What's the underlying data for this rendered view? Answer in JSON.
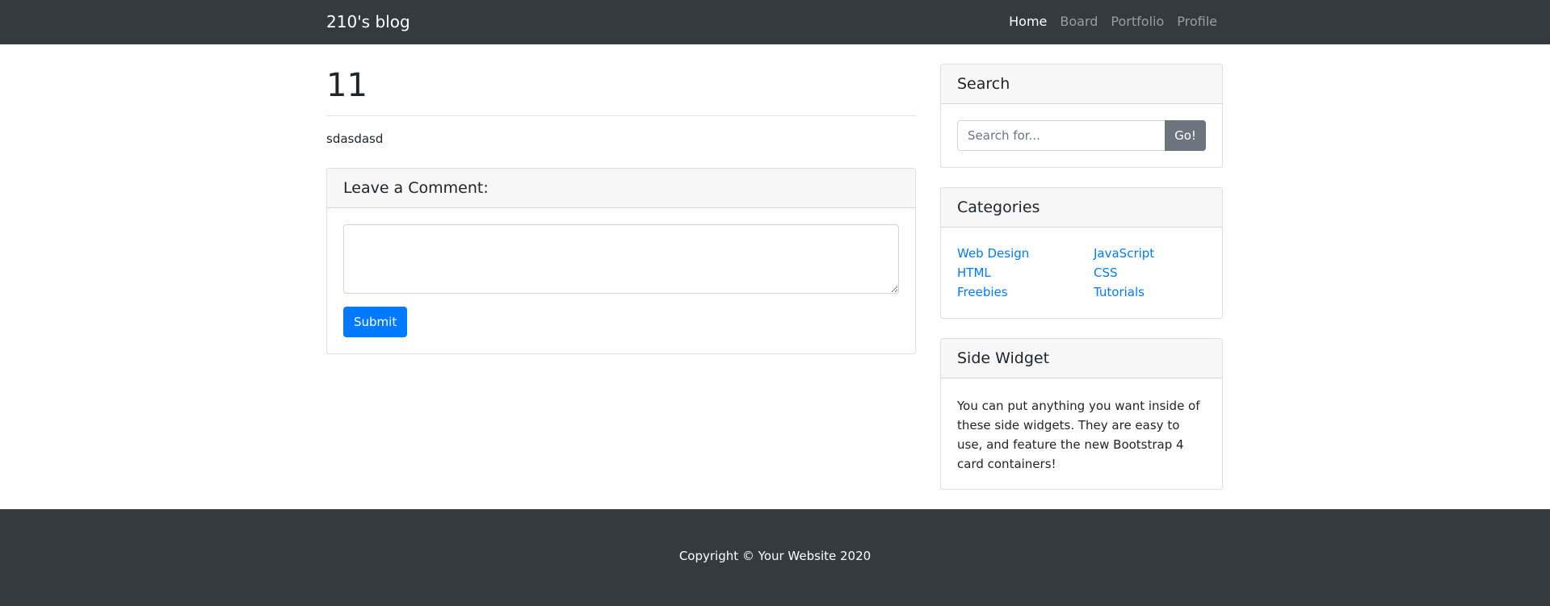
{
  "navbar": {
    "brand": "210's blog",
    "links": [
      {
        "label": "Home",
        "active": true
      },
      {
        "label": "Board",
        "active": false
      },
      {
        "label": "Portfolio",
        "active": false
      },
      {
        "label": "Profile",
        "active": false
      }
    ]
  },
  "post": {
    "title": "11",
    "body": "sdasdasd"
  },
  "comment": {
    "header": "Leave a Comment:",
    "textarea_value": "",
    "submit_label": "Submit"
  },
  "search": {
    "header": "Search",
    "placeholder": "Search for...",
    "button_label": "Go!"
  },
  "categories": {
    "header": "Categories",
    "items": [
      "Web Design",
      "JavaScript",
      "HTML",
      "CSS",
      "Freebies",
      "Tutorials"
    ]
  },
  "side_widget": {
    "header": "Side Widget",
    "text": "You can put anything you want inside of these side widgets. They are easy to use, and feature the new Bootstrap 4 card containers!"
  },
  "footer": {
    "copyright": "Copyright © Your Website 2020"
  },
  "colors": {
    "navbar_bg": "#343a40",
    "primary": "#007bff",
    "secondary": "#6c757d",
    "link": "#007bff"
  }
}
